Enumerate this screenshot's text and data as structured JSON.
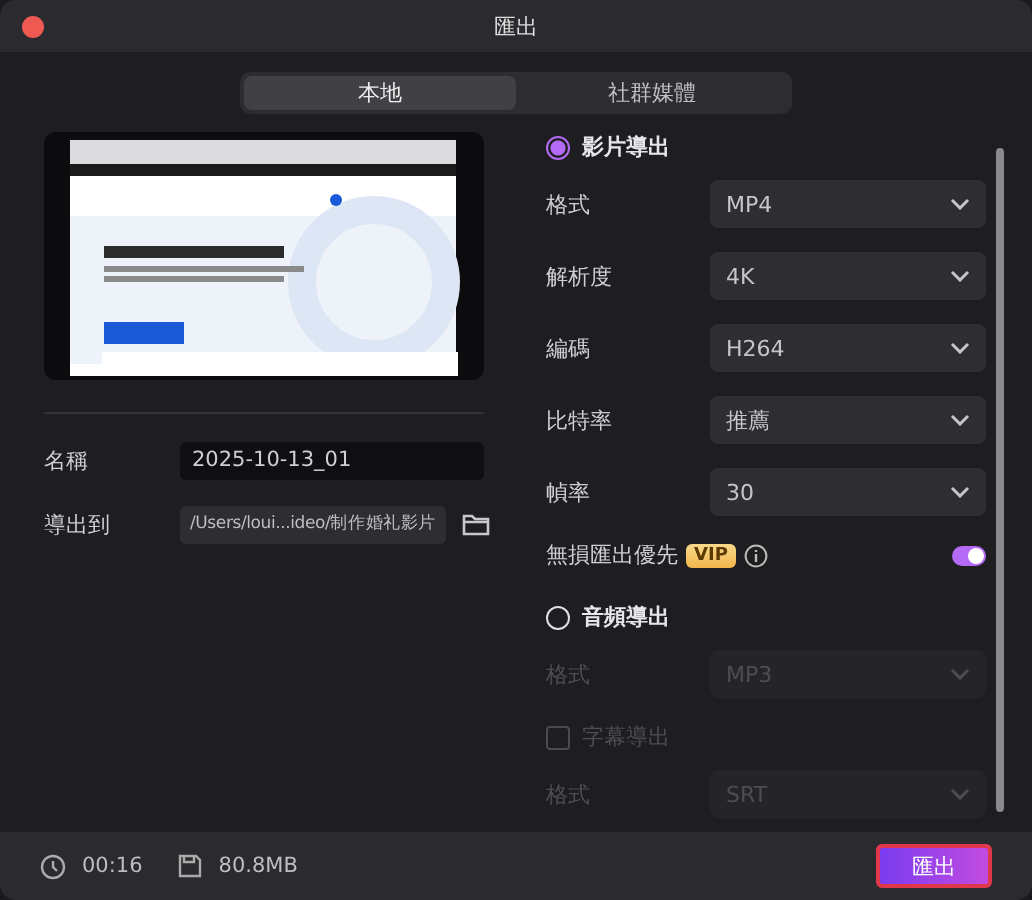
{
  "window": {
    "title": "匯出"
  },
  "tabs": [
    {
      "label": "本地",
      "selected": true
    },
    {
      "label": "社群媒體",
      "selected": false
    }
  ],
  "name_field": {
    "label": "名稱",
    "value": "2025-10-13_01"
  },
  "export_to": {
    "label": "導出到",
    "value": "/Users/loui...ideo/制作婚礼影片"
  },
  "video_export": {
    "label": "影片導出",
    "selected": true,
    "settings": [
      {
        "label": "格式",
        "value": "MP4",
        "disabled": false
      },
      {
        "label": "解析度",
        "value": "4K",
        "disabled": false
      },
      {
        "label": "編碼",
        "value": "H264",
        "disabled": false
      },
      {
        "label": "比特率",
        "value": "推薦",
        "disabled": false
      },
      {
        "label": "幀率",
        "value": "30",
        "disabled": false
      }
    ],
    "lossless": {
      "label": "無損匯出優先",
      "badge": "VIP",
      "on": true
    }
  },
  "audio_export": {
    "label": "音頻導出",
    "selected": false,
    "settings": [
      {
        "label": "格式",
        "value": "MP3",
        "disabled": true
      }
    ]
  },
  "subtitle_export": {
    "label": "字幕導出",
    "checked": false,
    "disabled": true,
    "settings": [
      {
        "label": "格式",
        "value": "SRT",
        "disabled": true
      }
    ]
  },
  "footer": {
    "duration": "00:16",
    "size": "80.8MB",
    "export_button": "匯出"
  }
}
